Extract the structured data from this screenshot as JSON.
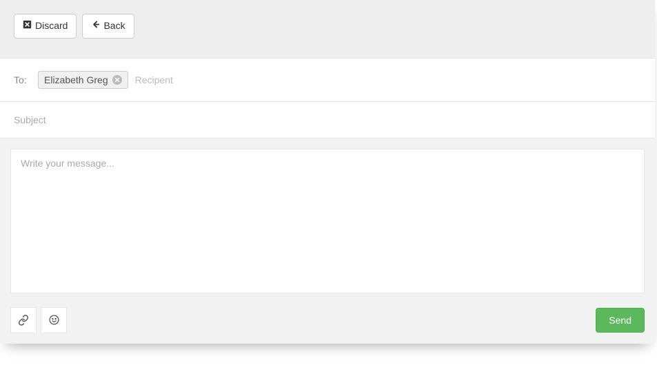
{
  "toolbar": {
    "discard_label": "Discard",
    "back_label": "Back"
  },
  "recipients": {
    "label": "To:",
    "chips": [
      {
        "name": "Elizabeth Greg"
      }
    ],
    "placeholder": "Recipent"
  },
  "subject": {
    "placeholder": "Subject",
    "value": ""
  },
  "body": {
    "placeholder": "Write your message...",
    "value": ""
  },
  "footer": {
    "send_label": "Send"
  }
}
